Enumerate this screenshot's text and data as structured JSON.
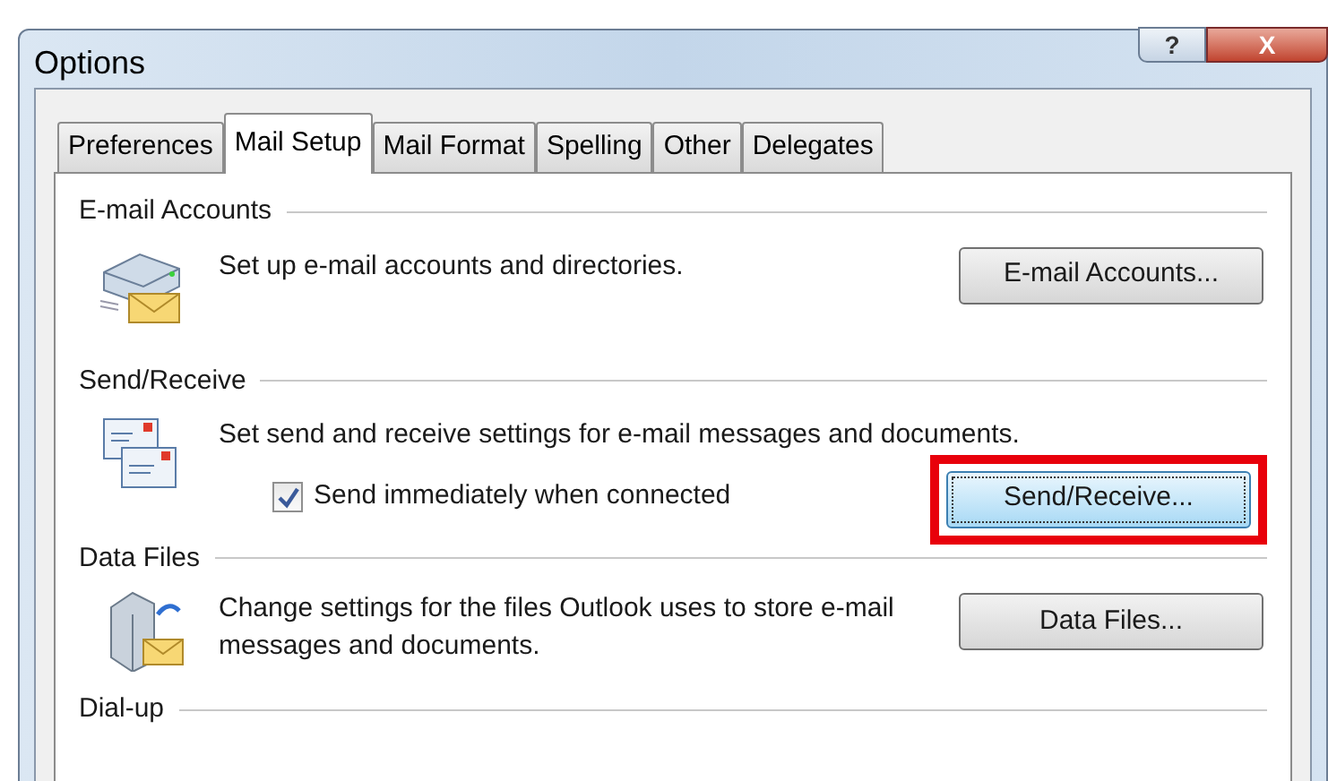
{
  "window": {
    "title": "Options",
    "help_button": "?",
    "close_button": "X"
  },
  "tabs": [
    {
      "label": "Preferences",
      "selected": false
    },
    {
      "label": "Mail Setup",
      "selected": true
    },
    {
      "label": "Mail Format",
      "selected": false
    },
    {
      "label": "Spelling",
      "selected": false
    },
    {
      "label": "Other",
      "selected": false
    },
    {
      "label": "Delegates",
      "selected": false
    }
  ],
  "sections": [
    {
      "kind": "accounts",
      "heading": "E-mail Accounts",
      "description": "Set up e-mail accounts and directories.",
      "button": {
        "label": "E-mail Accounts...",
        "focused": false,
        "highlighted": false
      }
    },
    {
      "kind": "sendreceive",
      "heading": "Send/Receive",
      "description": "Set send and receive settings for e-mail messages and documents.",
      "checkbox": {
        "label": "Send immediately when connected",
        "checked": true
      },
      "button": {
        "label": "Send/Receive...",
        "focused": true,
        "highlighted": true
      }
    },
    {
      "kind": "datafiles",
      "heading": "Data Files",
      "description": "Change settings for the files Outlook uses to store e-mail messages and documents.",
      "button": {
        "label": "Data Files...",
        "focused": false,
        "highlighted": false
      }
    },
    {
      "kind": "dialup",
      "heading": "Dial-up"
    }
  ]
}
